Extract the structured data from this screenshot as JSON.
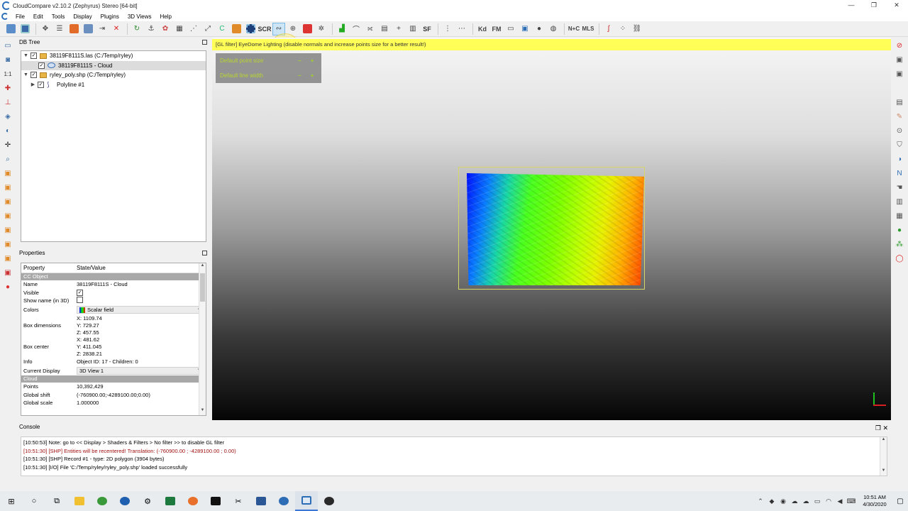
{
  "window": {
    "title": "CloudCompare v2.10.2 (Zephyrus) Stereo [64-bit]",
    "minimize": "—",
    "maximize": "❐",
    "close": "✕"
  },
  "menu": [
    "File",
    "Edit",
    "Tools",
    "Display",
    "Plugins",
    "3D Views",
    "Help"
  ],
  "toolbar": {
    "scr_label": "SCR",
    "sf_label": "SF",
    "kd_label": "Kd",
    "fm_label": "FM",
    "nc_label": "N+C",
    "mls_label": "MLS"
  },
  "dbtree": {
    "title": "DB Tree",
    "items": [
      {
        "label": "38119F8111S.las (C:/Temp/ryley)"
      },
      {
        "label": "38119F8111S - Cloud"
      },
      {
        "label": "ryley_poly.shp (C:/Temp/ryley)"
      },
      {
        "label": "Polyline #1"
      }
    ]
  },
  "properties": {
    "title": "Properties",
    "col_property": "Property",
    "col_value": "State/Value",
    "section_ccobject": "CC Object",
    "name_key": "Name",
    "name_val": "38119F8111S - Cloud",
    "visible_key": "Visible",
    "showname_key": "Show name (in 3D)",
    "colors_key": "Colors",
    "colors_val": "Scalar field",
    "boxdim_key": "Box dimensions",
    "boxdim_x": "X: 1109.74",
    "boxdim_y": "Y: 729.27",
    "boxdim_z": "Z: 457.55",
    "boxcenter_key": "Box center",
    "boxcenter_x": "X: 481.62",
    "boxcenter_y": "Y: 411.045",
    "boxcenter_z": "Z: 2838.21",
    "info_key": "Info",
    "info_val": "Object ID: 17 - Children: 0",
    "display_key": "Current Display",
    "display_val": "3D View 1",
    "section_cloud": "Cloud",
    "points_key": "Points",
    "points_val": "10,392,429",
    "shift_key": "Global shift",
    "shift_val": "(-760900.00;-4289100.00;0.00)",
    "scale_key": "Global scale",
    "scale_val": "1.000000"
  },
  "view3d": {
    "banner": "[GL filter] EyeDome Lighting (disable normals and increase points size for a better result!)",
    "overlay": [
      "Default point size",
      "Default line width"
    ],
    "overlay_minus": "−",
    "overlay_plus": "+"
  },
  "console": {
    "title": "Console",
    "lines": [
      {
        "text": "[10:50:53] Note: go to << Display > Shaders & Filters > No filter >> to disable GL filter"
      },
      {
        "text": "[10:51:30] [SHP] Entities will be recentered! Translation: (-760900.00 ; -4289100.00 ; 0.00)"
      },
      {
        "text": "[10:51:30] [SHP] Record #1 - type: 2D polygon (3904 bytes)"
      },
      {
        "text": "[10:51:30] [I/O] File 'C:/Temp/ryley/ryley_poly.shp' loaded successfully"
      }
    ]
  },
  "taskbar": {
    "time": "10:51 AM",
    "date": "4/30/2020"
  },
  "colors": {
    "banner": "#ffff57",
    "overlay_text": "#b7d52f",
    "accent": "#3b78d6"
  }
}
